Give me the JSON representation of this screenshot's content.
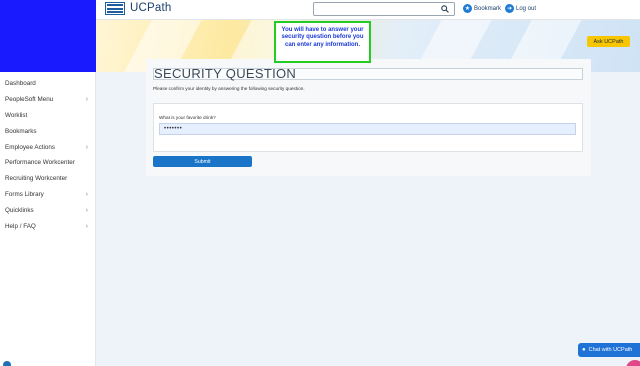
{
  "app": {
    "title": "UCPath"
  },
  "search": {
    "value": "",
    "icon": "search-icon"
  },
  "topbar": {
    "bookmark_label": "Bookmark",
    "logout_label": "Log out"
  },
  "sidebar": {
    "items": [
      {
        "label": "Dashboard",
        "chevron": false
      },
      {
        "label": "PeopleSoft Menu",
        "chevron": true
      },
      {
        "label": "Worklist",
        "chevron": false
      },
      {
        "label": "Bookmarks",
        "chevron": false
      },
      {
        "label": "Employee Actions",
        "chevron": true
      },
      {
        "label": "Performance Workcenter",
        "chevron": false
      },
      {
        "label": "Recruiting Workcenter",
        "chevron": false
      },
      {
        "label": "Forms Library",
        "chevron": true
      },
      {
        "label": "Quicklinks",
        "chevron": true
      },
      {
        "label": "Help / FAQ",
        "chevron": true
      }
    ]
  },
  "banner": {
    "ask_label": "Ask UCPath"
  },
  "callout": {
    "text": "You will have to answer your security question before you can enter any information."
  },
  "main": {
    "title": "SECURITY QUESTION",
    "instruction": "Please confirm your identity by answering the following security question.",
    "question_label": "What is your favorite drink?",
    "answer_value": "•••••••",
    "submit_label": "Submit"
  },
  "chat": {
    "label": "Chat with UCPath"
  },
  "colors": {
    "accent": "#1a75c9",
    "brand_block": "#1a1aff",
    "callout_border": "#22cc22",
    "ask_button": "#f7c600"
  }
}
